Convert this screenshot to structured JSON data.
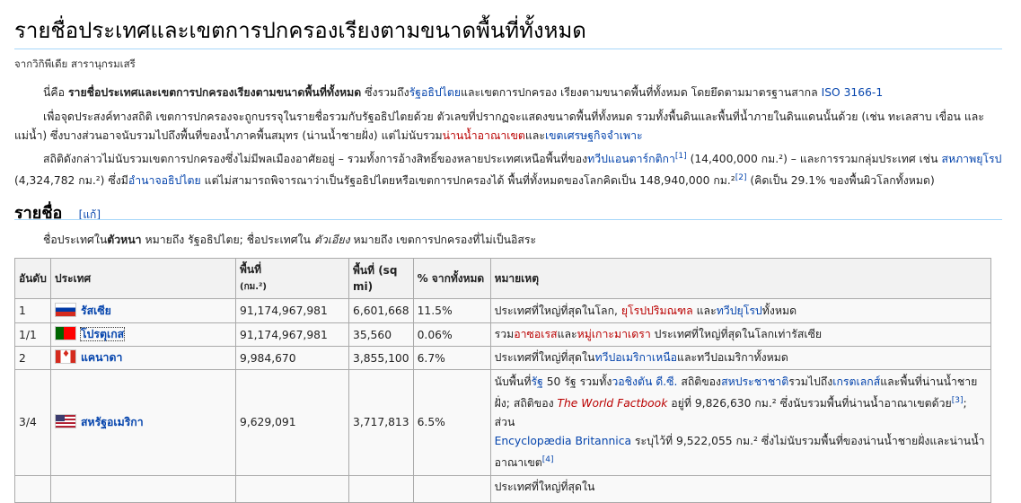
{
  "page": {
    "title": "รายชื่อประเทศและเขตการปกครองเรียงตามขนาดพื้นที่ทั้งหมด",
    "from": "จากวิกิพีเดีย สารานุกรมเสรี"
  },
  "intro": {
    "p1_a": "นี่คือ ",
    "p1_b": "รายชื่อประเทศและเขตการปกครองเรียงตามขนาดพื้นที่ทั้งหมด",
    "p1_c": " ซึ่งรวมถึง",
    "p1_link1": "รัฐอธิปไตย",
    "p1_d": "และเขตการปกครอง เรียงตามขนาดพื้นที่ทั้งหมด โดยยึดตามมาตรฐานสากล ",
    "p1_link2": "ISO 3166-1",
    "p2_a": "เพื่อจุดประสงค์ทางสถิติ เขตการปกครองจะถูกบรรจุในรายชื่อรวมกับรัฐอธิปไตยด้วย ตัวเลขที่ปรากฏจะแสดงขนาดพื้นที่ทั้งหมด รวมทั้งพื้นดินและพื้นที่น้ำภายในดินแดนนั้นด้วย (เช่น ทะเลสาบ เขื่อน และแม่น้ำ) ซึ่งบางส่วนอาจนับรวมไปถึงพื้นที่ของน้ำภาคพื้นสมุทร (น่านน้ำชายฝั่ง) แต่ไม่นับรวม",
    "p2_link1": "น่านน้ำอาณาเขต",
    "p2_b": "และ",
    "p2_link2": "เขตเศรษฐกิจจำเพาะ",
    "p3_a": "สถิติดังกล่าวไม่นับรวมเขตการปกครองซึ่งไม่มีพลเมืองอาศัยอยู่ – รวมทั้งการอ้างสิทธิ์ของหลายประเทศเหนือพื้นที่ของ",
    "p3_link1": "ทวีปแอนตาร์กติกา",
    "p3_ref1": "[1]",
    "p3_b": " (14,400,000 กม.²) – และการรวมกลุ่มประเทศ เช่น ",
    "p3_link2": "สหภาพยุโรป",
    "p3_c": " (4,324,782 กม.²) ซึ่งมี",
    "p3_link3": "อำนาจอธิปไตย",
    "p3_d": " แต่ไม่สามารถพิจารณาว่าเป็นรัฐอธิปไตยหรือเขตการปกครองได้ พื้นที่ทั้งหมดของโลกคิดเป็น 148,940,000 กม.²",
    "p3_ref2": "[2]",
    "p3_e": " (คิดเป็น 29.1% ของพื้นผิวโลกทั้งหมด)"
  },
  "section": {
    "heading": "รายชื่อ",
    "edit": "[แก้]",
    "note_a": "ชื่อประเทศใน",
    "note_bold": "ตัวหนา",
    "note_b": " หมายถึง รัฐอธิปไตย; ชื่อประเทศใน ",
    "note_ital": "ตัวเอียง",
    "note_c": " หมายถึง เขตการปกครองที่ไม่เป็นอิสระ"
  },
  "table": {
    "headers": {
      "rank": "อันดับ",
      "country": "ประเทศ",
      "area_km": "พื้นที่",
      "area_km_unit": "(กม.²)",
      "area_mi": "พื้นที่ (sq mi)",
      "pct": "% จากทั้งหมด",
      "notes": "หมายเหตุ"
    },
    "rows": [
      {
        "rank": "1",
        "country": "รัสเซีย",
        "flag": "flag-ru",
        "km": "91,174,967,981",
        "mi": "6,601,668",
        "pct": "11.5%",
        "n1": "ประเทศที่ใหญ่ที่สุดในโลก, ",
        "n_link1": "ยุโรปปริมณฑล",
        "n2": " และ",
        "n_link2": "ทวีปยุโรป",
        "n3": "ทั้งหมด"
      },
      {
        "rank": "1/1",
        "country": "โปรตุเกส",
        "flag": "flag-pt",
        "km": "91,174,967,981",
        "mi": "35,560",
        "pct": "0.06%",
        "n1": "รวม",
        "n_link1": "อาซอเรส",
        "n2": "และ",
        "n_link2": "หมู่เกาะมาเดรา",
        "n3": " ประเทศที่ใหญ่ที่สุดในโลกเท่ารัสเซีย"
      },
      {
        "rank": "2",
        "country": "แคนาดา",
        "flag": "flag-ca",
        "km": "9,984,670",
        "mi": "3,855,100",
        "pct": "6.7%",
        "n1": "ประเทศที่ใหญ่ที่สุดใน",
        "n_link1": "ทวีปอเมริกาเหนือ",
        "n2": "และทวีปอเมริกาทั้งหมด",
        "n_link2": "",
        "n3": ""
      },
      {
        "rank": "3/4",
        "country": "สหรัฐอเมริกา",
        "flag": "flag-us",
        "km": "9,629,091",
        "mi": "3,717,813",
        "pct": "6.5%",
        "l1a": "นับพื้นที่",
        "l1link1": "รัฐ",
        "l1b": " 50 รัฐ รวมทั้ง",
        "l1link2": "วอชิงตัน ดี.ซี.",
        "l1c": " สถิติของ",
        "l1link3": "สหประชาชาติ",
        "l1d": "รวมไปถึง",
        "l1link4": "เกรตเลกส์",
        "l1e": "และพื้นที่น่านน้ำชาย",
        "l2a": "ฝั่ง; สถิติของ ",
        "l2link1": "The World Factbook",
        "l2b": " อยู่ที่ 9,826,630 กม.² ซึ่งนับรวมพื้นที่น่านน้ำอาณาเขตด้วย",
        "l2ref": "[3]",
        "l2c": "; ส่วน",
        "l3link": "Encyclopædia Britannica",
        "l3b": " ระบุไว้ที่ 9,522,055 กม.² ซึ่งไม่นับรวมพื้นที่ของน่านน้ำชายฝั่งและน่านน้ำ",
        "l4a": "อาณาเขต",
        "l4ref": "[4]"
      }
    ],
    "partial": "ประเทศที่ใหญ่ที่สุดใน"
  }
}
